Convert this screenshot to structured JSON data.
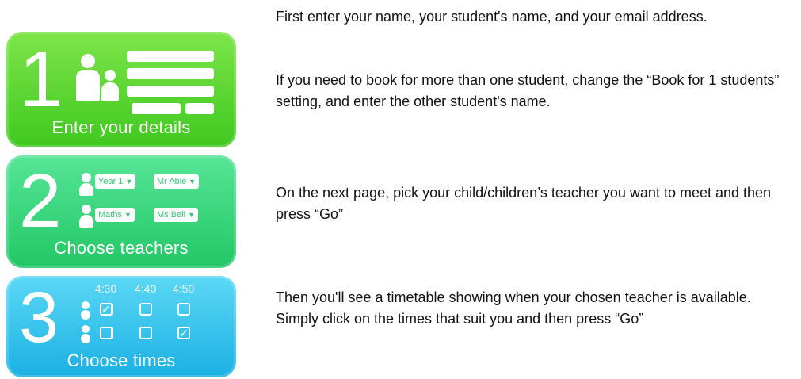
{
  "steps": [
    {
      "number": "1",
      "caption": "Enter your details",
      "icon": "people-form-icon",
      "color_top": "#7ee54a",
      "color_bottom": "#3fc81f"
    },
    {
      "number": "2",
      "caption": "Choose teachers",
      "icon": "people-dropdowns-icon",
      "rows": [
        {
          "subject": "Year 1",
          "teacher": "Mr Able"
        },
        {
          "subject": "Maths",
          "teacher": "Ms Bell"
        }
      ],
      "color_top": "#56e596",
      "color_bottom": "#22c766"
    },
    {
      "number": "3",
      "caption": "Choose times",
      "icon": "people-checkboxes-icon",
      "times": [
        "4:30",
        "4:40",
        "4:50"
      ],
      "checked": [
        [
          true,
          false,
          false
        ],
        [
          false,
          false,
          true
        ]
      ],
      "color_top": "#5bd8f5",
      "color_bottom": "#1bb0e4"
    }
  ],
  "instructions": {
    "step1_p1": "First enter your name, your student's name, and your email address.",
    "step1_p2": "If you need to book for more than one student, change the “Book for 1 students” setting, and enter the other student's name.",
    "step2": "On the next page, pick your child/children’s teacher you want to meet and then press “Go”",
    "step3": "Then you'll see a timetable showing when your chosen teacher is available. Simply click on the times that suit you and then press “Go”"
  }
}
